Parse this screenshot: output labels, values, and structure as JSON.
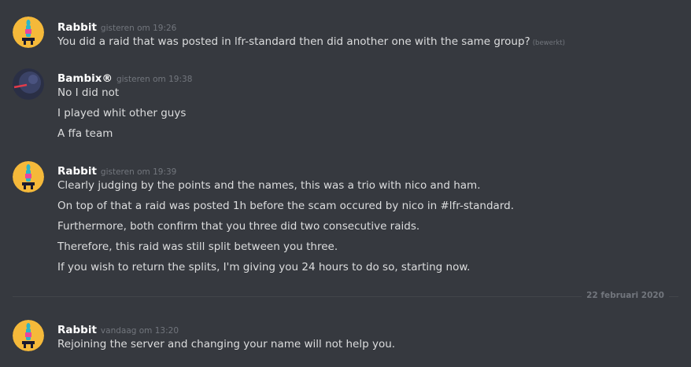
{
  "messages": [
    {
      "author": "Rabbit",
      "timestamp": "gisteren om 19:26",
      "lines": [
        "You did a raid that was posted in lfr-standard then did another one with the same group?"
      ],
      "edited_label": "(bewerkt)"
    },
    {
      "author": "Bambix®",
      "timestamp": "gisteren om 19:38",
      "lines": [
        "No I did not",
        "I played whit other guys",
        "A ffa team"
      ]
    },
    {
      "author": "Rabbit",
      "timestamp": "gisteren om 19:39",
      "lines": [
        "Clearly judging by the points and the names, this was a trio with nico and ham.",
        "On top of that a raid was posted 1h before the scam occured by nico in #lfr-standard.",
        "Furthermore, both confirm that you three did two consecutive raids.",
        "Therefore, this raid was still split between you three.",
        "If you wish to return the splits, I'm giving you 24 hours to do so, starting now."
      ]
    },
    {
      "author": "Rabbit",
      "timestamp": "vandaag om 13:20",
      "lines": [
        "Rejoining the server and changing your name will not help you."
      ]
    }
  ],
  "date_divider": "22 februari 2020",
  "colors": {
    "background": "#36393f",
    "username": "#ffffff",
    "message_text": "#dcddde",
    "muted": "#72767d",
    "rabbit_avatar_bg": "#f5b93a",
    "bambix_avatar_bg": "#2a2f45"
  }
}
